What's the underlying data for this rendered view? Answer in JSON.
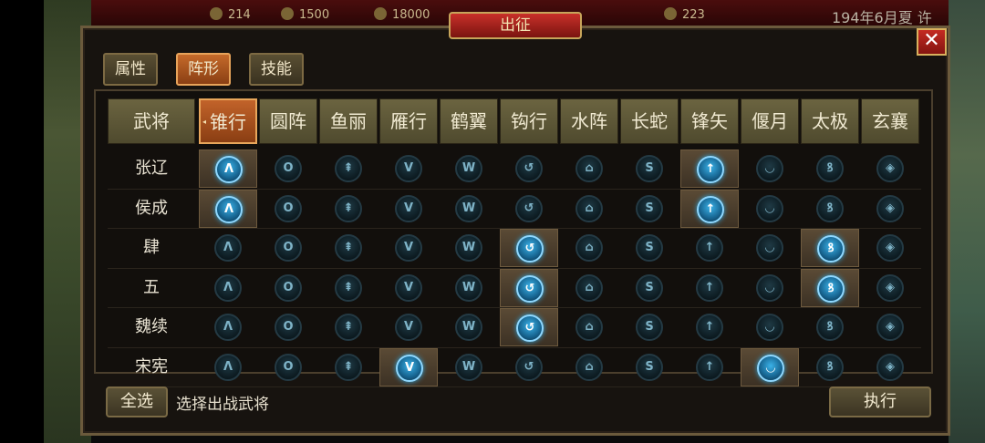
{
  "topbar": {
    "resources": [
      {
        "icon": "grain-icon",
        "value": "214"
      },
      {
        "icon": "gold-icon",
        "value": "1500"
      },
      {
        "icon": "troops-icon",
        "value": "18000"
      },
      {
        "icon": "token-icon",
        "value": "223"
      }
    ],
    "date": "194年6月夏 许"
  },
  "dialog": {
    "title": "出征",
    "close_label": "✕",
    "tabs": [
      {
        "label": "属性",
        "active": false
      },
      {
        "label": "阵形",
        "active": true
      },
      {
        "label": "技能",
        "active": false
      }
    ]
  },
  "table": {
    "header_first": "武将",
    "formations": [
      "锥行",
      "圆阵",
      "鱼丽",
      "雁行",
      "鹤翼",
      "钩行",
      "水阵",
      "长蛇",
      "锋矢",
      "偃月",
      "太极",
      "玄襄"
    ],
    "selected_formation": 0,
    "formation_glyphs": [
      "Λ",
      "O",
      "⇞",
      "V",
      "W",
      "↺",
      "⌂",
      "S",
      "↑",
      "◡",
      "ꝸ",
      "◈"
    ],
    "rows": [
      {
        "name": "张辽",
        "highlight": [
          0,
          8
        ]
      },
      {
        "name": "侯成",
        "highlight": [
          0,
          8
        ]
      },
      {
        "name": "肆",
        "highlight": [
          5,
          10
        ]
      },
      {
        "name": "五",
        "highlight": [
          5,
          10
        ]
      },
      {
        "name": "魏续",
        "highlight": [
          5
        ]
      },
      {
        "name": "宋宪",
        "highlight": [
          3,
          9
        ]
      }
    ]
  },
  "footer": {
    "select_all": "全选",
    "hint": "选择出战武将",
    "execute": "执行"
  }
}
